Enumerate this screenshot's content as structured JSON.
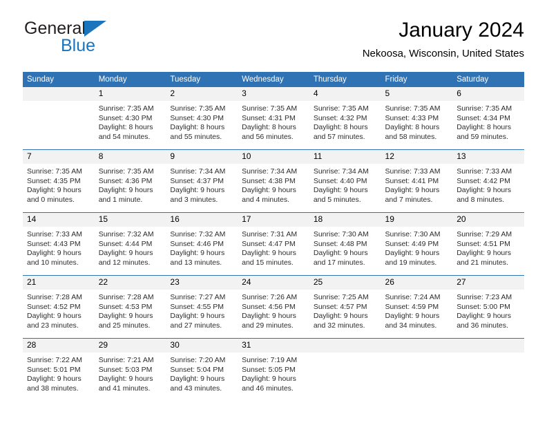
{
  "brand": {
    "name_part1": "General",
    "name_part2": "Blue",
    "color_dark": "#231f20",
    "color_blue": "#1b75bc"
  },
  "header": {
    "title": "January 2024",
    "subtitle": "Nekoosa, Wisconsin, United States"
  },
  "theme": {
    "header_blue": "#3073b5",
    "daynum_band": "#f2f2f2",
    "text": "#000000"
  },
  "weekday_headers": [
    "Sunday",
    "Monday",
    "Tuesday",
    "Wednesday",
    "Thursday",
    "Friday",
    "Saturday"
  ],
  "weeks": [
    [
      {
        "day": "",
        "blank": true
      },
      {
        "day": "1",
        "sunrise": "Sunrise: 7:35 AM",
        "sunset": "Sunset: 4:30 PM",
        "daylight_line1": "Daylight: 8 hours",
        "daylight_line2": "and 54 minutes."
      },
      {
        "day": "2",
        "sunrise": "Sunrise: 7:35 AM",
        "sunset": "Sunset: 4:30 PM",
        "daylight_line1": "Daylight: 8 hours",
        "daylight_line2": "and 55 minutes."
      },
      {
        "day": "3",
        "sunrise": "Sunrise: 7:35 AM",
        "sunset": "Sunset: 4:31 PM",
        "daylight_line1": "Daylight: 8 hours",
        "daylight_line2": "and 56 minutes."
      },
      {
        "day": "4",
        "sunrise": "Sunrise: 7:35 AM",
        "sunset": "Sunset: 4:32 PM",
        "daylight_line1": "Daylight: 8 hours",
        "daylight_line2": "and 57 minutes."
      },
      {
        "day": "5",
        "sunrise": "Sunrise: 7:35 AM",
        "sunset": "Sunset: 4:33 PM",
        "daylight_line1": "Daylight: 8 hours",
        "daylight_line2": "and 58 minutes."
      },
      {
        "day": "6",
        "sunrise": "Sunrise: 7:35 AM",
        "sunset": "Sunset: 4:34 PM",
        "daylight_line1": "Daylight: 8 hours",
        "daylight_line2": "and 59 minutes."
      }
    ],
    [
      {
        "day": "7",
        "sunrise": "Sunrise: 7:35 AM",
        "sunset": "Sunset: 4:35 PM",
        "daylight_line1": "Daylight: 9 hours",
        "daylight_line2": "and 0 minutes."
      },
      {
        "day": "8",
        "sunrise": "Sunrise: 7:35 AM",
        "sunset": "Sunset: 4:36 PM",
        "daylight_line1": "Daylight: 9 hours",
        "daylight_line2": "and 1 minute."
      },
      {
        "day": "9",
        "sunrise": "Sunrise: 7:34 AM",
        "sunset": "Sunset: 4:37 PM",
        "daylight_line1": "Daylight: 9 hours",
        "daylight_line2": "and 3 minutes."
      },
      {
        "day": "10",
        "sunrise": "Sunrise: 7:34 AM",
        "sunset": "Sunset: 4:38 PM",
        "daylight_line1": "Daylight: 9 hours",
        "daylight_line2": "and 4 minutes."
      },
      {
        "day": "11",
        "sunrise": "Sunrise: 7:34 AM",
        "sunset": "Sunset: 4:40 PM",
        "daylight_line1": "Daylight: 9 hours",
        "daylight_line2": "and 5 minutes."
      },
      {
        "day": "12",
        "sunrise": "Sunrise: 7:33 AM",
        "sunset": "Sunset: 4:41 PM",
        "daylight_line1": "Daylight: 9 hours",
        "daylight_line2": "and 7 minutes."
      },
      {
        "day": "13",
        "sunrise": "Sunrise: 7:33 AM",
        "sunset": "Sunset: 4:42 PM",
        "daylight_line1": "Daylight: 9 hours",
        "daylight_line2": "and 8 minutes."
      }
    ],
    [
      {
        "day": "14",
        "sunrise": "Sunrise: 7:33 AM",
        "sunset": "Sunset: 4:43 PM",
        "daylight_line1": "Daylight: 9 hours",
        "daylight_line2": "and 10 minutes."
      },
      {
        "day": "15",
        "sunrise": "Sunrise: 7:32 AM",
        "sunset": "Sunset: 4:44 PM",
        "daylight_line1": "Daylight: 9 hours",
        "daylight_line2": "and 12 minutes."
      },
      {
        "day": "16",
        "sunrise": "Sunrise: 7:32 AM",
        "sunset": "Sunset: 4:46 PM",
        "daylight_line1": "Daylight: 9 hours",
        "daylight_line2": "and 13 minutes."
      },
      {
        "day": "17",
        "sunrise": "Sunrise: 7:31 AM",
        "sunset": "Sunset: 4:47 PM",
        "daylight_line1": "Daylight: 9 hours",
        "daylight_line2": "and 15 minutes."
      },
      {
        "day": "18",
        "sunrise": "Sunrise: 7:30 AM",
        "sunset": "Sunset: 4:48 PM",
        "daylight_line1": "Daylight: 9 hours",
        "daylight_line2": "and 17 minutes."
      },
      {
        "day": "19",
        "sunrise": "Sunrise: 7:30 AM",
        "sunset": "Sunset: 4:49 PM",
        "daylight_line1": "Daylight: 9 hours",
        "daylight_line2": "and 19 minutes."
      },
      {
        "day": "20",
        "sunrise": "Sunrise: 7:29 AM",
        "sunset": "Sunset: 4:51 PM",
        "daylight_line1": "Daylight: 9 hours",
        "daylight_line2": "and 21 minutes."
      }
    ],
    [
      {
        "day": "21",
        "sunrise": "Sunrise: 7:28 AM",
        "sunset": "Sunset: 4:52 PM",
        "daylight_line1": "Daylight: 9 hours",
        "daylight_line2": "and 23 minutes."
      },
      {
        "day": "22",
        "sunrise": "Sunrise: 7:28 AM",
        "sunset": "Sunset: 4:53 PM",
        "daylight_line1": "Daylight: 9 hours",
        "daylight_line2": "and 25 minutes."
      },
      {
        "day": "23",
        "sunrise": "Sunrise: 7:27 AM",
        "sunset": "Sunset: 4:55 PM",
        "daylight_line1": "Daylight: 9 hours",
        "daylight_line2": "and 27 minutes."
      },
      {
        "day": "24",
        "sunrise": "Sunrise: 7:26 AM",
        "sunset": "Sunset: 4:56 PM",
        "daylight_line1": "Daylight: 9 hours",
        "daylight_line2": "and 29 minutes."
      },
      {
        "day": "25",
        "sunrise": "Sunrise: 7:25 AM",
        "sunset": "Sunset: 4:57 PM",
        "daylight_line1": "Daylight: 9 hours",
        "daylight_line2": "and 32 minutes."
      },
      {
        "day": "26",
        "sunrise": "Sunrise: 7:24 AM",
        "sunset": "Sunset: 4:59 PM",
        "daylight_line1": "Daylight: 9 hours",
        "daylight_line2": "and 34 minutes."
      },
      {
        "day": "27",
        "sunrise": "Sunrise: 7:23 AM",
        "sunset": "Sunset: 5:00 PM",
        "daylight_line1": "Daylight: 9 hours",
        "daylight_line2": "and 36 minutes."
      }
    ],
    [
      {
        "day": "28",
        "sunrise": "Sunrise: 7:22 AM",
        "sunset": "Sunset: 5:01 PM",
        "daylight_line1": "Daylight: 9 hours",
        "daylight_line2": "and 38 minutes."
      },
      {
        "day": "29",
        "sunrise": "Sunrise: 7:21 AM",
        "sunset": "Sunset: 5:03 PM",
        "daylight_line1": "Daylight: 9 hours",
        "daylight_line2": "and 41 minutes."
      },
      {
        "day": "30",
        "sunrise": "Sunrise: 7:20 AM",
        "sunset": "Sunset: 5:04 PM",
        "daylight_line1": "Daylight: 9 hours",
        "daylight_line2": "and 43 minutes."
      },
      {
        "day": "31",
        "sunrise": "Sunrise: 7:19 AM",
        "sunset": "Sunset: 5:05 PM",
        "daylight_line1": "Daylight: 9 hours",
        "daylight_line2": "and 46 minutes."
      },
      {
        "day": "",
        "blank": true
      },
      {
        "day": "",
        "blank": true
      },
      {
        "day": "",
        "blank": true
      }
    ]
  ]
}
